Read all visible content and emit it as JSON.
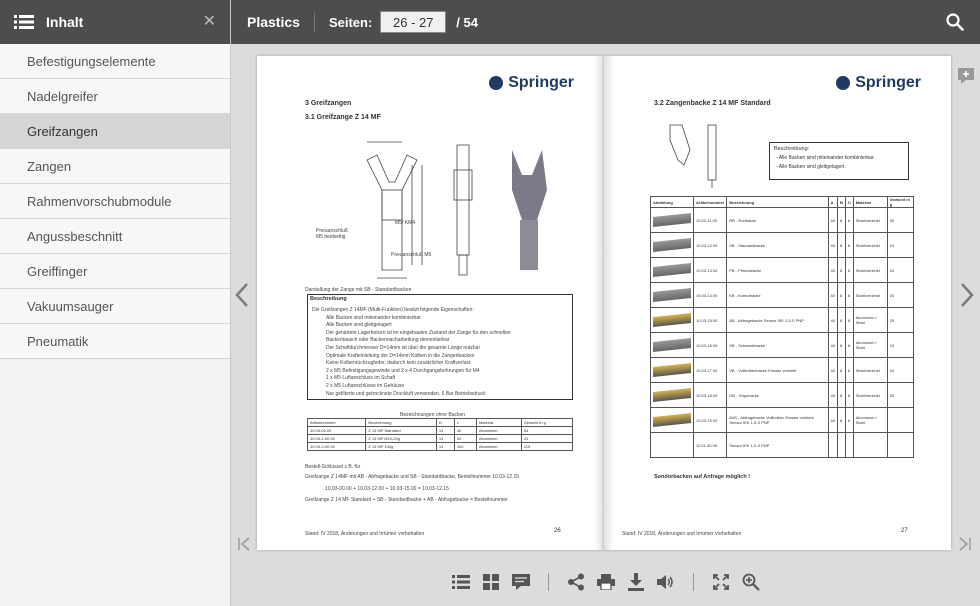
{
  "sidebar": {
    "title": "Inhalt",
    "items": [
      {
        "label": "Befestigungselemente",
        "active": false
      },
      {
        "label": "Nadelgreifer",
        "active": false
      },
      {
        "label": "Greifzangen",
        "active": true
      },
      {
        "label": "Zangen",
        "active": false
      },
      {
        "label": "Rahmenvorschubmodule",
        "active": false
      },
      {
        "label": "Angussbeschnitt",
        "active": false
      },
      {
        "label": "Greiffinger",
        "active": false
      },
      {
        "label": "Vakuumsauger",
        "active": false
      },
      {
        "label": "Pneumatik",
        "active": false
      }
    ]
  },
  "topbar": {
    "doc_title": "Plastics",
    "pages_label": "Seiten:",
    "page_value": "26 - 27",
    "total": "/ 54"
  },
  "left_page": {
    "logo": "Springer",
    "heading1": "3    Greifzangen",
    "heading2": "3.1    Greifzange Z 14 MF",
    "label_airport": "Pneuanschluß",
    "label_airport2": "M5 beidseitig",
    "label_m5km4": "M5/ KM4",
    "label_pneu_m5": "Pneuanschluß M5",
    "caption": "Darstellung der Zange mit SB - Standardbacken",
    "desc_title": "Beschreibung",
    "desc_lines": [
      "Die Greifzangen Z 14MF (Multi-Funktion) besitzt folgende Eigenschaften:",
      "Alle Backen sind miteinander kombinierbar",
      "Alle Backen sind gleitgelagert",
      "Der gehärtete Lagerbolzen ist im eingebauten Zustand der Zange für den schnellen",
      "Backentausch oder Backennacharbeitung demontierbar",
      "Der Schaftdurchmesser D=14mm ist über die gesamte Länge nutzbar",
      "Optimale Krafteinleitung der D=14mm Kolben in die Zangenbacken",
      "Keine Kolbenrückzugfeder, dadurch kein zusätzlicher Kraftverlust",
      "2 x M5 Befestigungsgewinde und 2 x 4 Durchgangsbohrungen für M4",
      "1 x M5 Luftanschluss im Schaft",
      "2 x M5 Luftanschlüsse im Gehäuse",
      "Nur gefilterte und getrocknete Druckluft verwenden. 6 Bar Betriebsdruck"
    ],
    "table_title": "Bezeichnungen ohne Backen",
    "table_headers": [
      "Artikelnummer",
      "Bezeichnung",
      "D",
      "L",
      "Material",
      "Gewicht in g"
    ],
    "table_rows": [
      [
        "10.03-00.00",
        "Z 14 MF Standard",
        "14",
        "40",
        "Aluminium",
        "54"
      ],
      [
        "10.03-1-00.00",
        "Z 14 MF Ø10-20g",
        "14",
        "20",
        "Aluminium",
        "41"
      ],
      [
        "10.03-2-00.00",
        "Z 14 MF 100g",
        "14",
        "100",
        "Aluminium",
        "119"
      ]
    ],
    "order_line1": "Bestell-Schlüssel z.B. für",
    "order_line2": "Greifzange Z 14MF mit AB - Abfragebacke und SB - Standardbacke, Bestellnummer 10.03-12.15",
    "order_line3": "10.03-00.00    +    10.03-12.00   +   10.03-15.00   =  10.03-12.15",
    "order_line4": "Greifzange Z 14 MF Standard   +   SB - Standardbacke   +   AB - Abfragebacke   = Bestellnummer",
    "footer": "Stand: IV 2018, Änderungen und Irrtümer vorbehalten",
    "page_number": "26"
  },
  "right_page": {
    "logo": "Springer",
    "heading": "3.2    Zangenbacke Z 14 MF Standard",
    "desc_title": "Beschreibung:",
    "desc_lines": [
      "-  Alle Backen sind miteinander kombinierbar.",
      "-  Alle Backen sind gleitgelagert."
    ],
    "table_headers": [
      "Abbildung",
      "Artikelnummer",
      "Bezeichnung",
      "A",
      "B",
      "C",
      "Material",
      "Gewicht in g"
    ],
    "table_rows": [
      {
        "art": "10.03-11.00",
        "name": "RB - Rohbacke",
        "a": "40",
        "b": "8",
        "c": "6",
        "mat": "Stahl/verzinkt",
        "w": "30",
        "yellow": false
      },
      {
        "art": "10.03-12.00",
        "name": "SB - Standardbacke",
        "a": "40",
        "b": "8",
        "c": "6",
        "mat": "Stahl/verzinkt",
        "w": "24",
        "yellow": false
      },
      {
        "art": "10.03-13.00",
        "name": "PB - Prismabacke",
        "a": "40",
        "b": "8",
        "c": "6",
        "mat": "Stahl/verzinkt",
        "w": "24",
        "yellow": false
      },
      {
        "art": "10.03-14.00",
        "name": "KB - Konturbacke",
        "a": "40",
        "b": "8",
        "c": "6",
        "mat": "Stahl/verzinkt",
        "w": "24",
        "yellow": false
      },
      {
        "art": "10.03-15.00",
        "name": "AB - Abfragebacke Sensor IEK 1,5-S PNP",
        "a": "40",
        "b": "8",
        "c": "6",
        "mat": "Aluminium / Stahl",
        "w": "29",
        "yellow": true
      },
      {
        "art": "10.03-16.00",
        "name": "SB - Schwenkbacke",
        "a": "40",
        "b": "8",
        "c": "6",
        "mat": "Aluminium / Stahl",
        "w": "15",
        "yellow": false
      },
      {
        "art": "10.03-17.00",
        "name": "VB - Vollkolbenbacke Einsatz verklebt",
        "a": "40",
        "b": "8",
        "c": "6",
        "mat": "Stahl/verzinkt",
        "w": "24",
        "yellow": true
      },
      {
        "art": "10.03-18.00",
        "name": "GB - Grippbacke",
        "a": "40",
        "b": "8",
        "c": "6",
        "mat": "Stahl/verzinkt",
        "w": "25",
        "yellow": true
      },
      {
        "art": "10.03-15.00",
        "name": "AVB - Abfragebacke Vollkolben Einsatz verklebt Sensor IEK 1,5-S PNP",
        "a": "40",
        "b": "8",
        "c": "6",
        "mat": "Aluminium / Stahl",
        "w": "",
        "yellow": true
      },
      {
        "art": "11.01-30.00",
        "name": "Sensor IEK 1,5-S PNP",
        "a": "",
        "b": "",
        "c": "",
        "mat": "",
        "w": "",
        "yellow": false
      }
    ],
    "note": "Sondorbacken auf Anfrage möglich !",
    "footer": "Stand: IV 2018, Änderungen und Irrtümer vorbehalten",
    "page_number": "27"
  }
}
